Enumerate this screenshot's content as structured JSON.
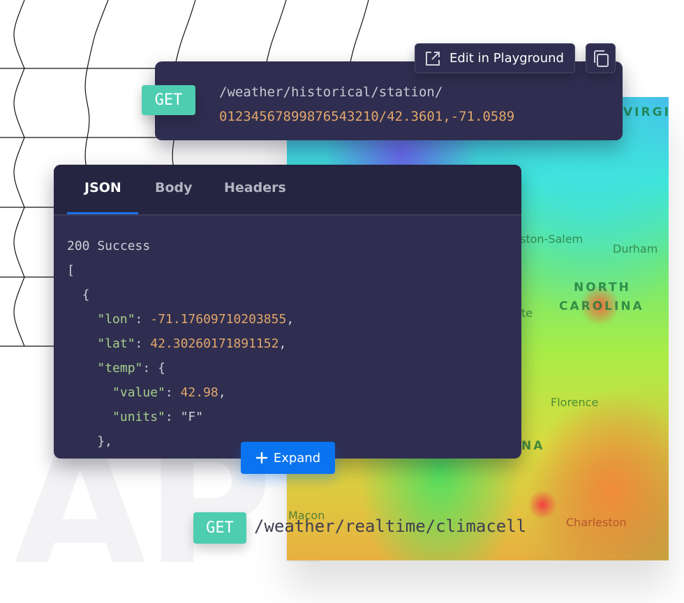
{
  "map": {
    "labels": {
      "virginia": "VIRGI",
      "winston_salem": "ston-Salem",
      "durham": "Durham",
      "state_line1": "NORTH",
      "state_line2": "CAROLINA",
      "partial_te": "te",
      "florence": "Florence",
      "partial_na": "NA",
      "macon": "Macon",
      "charleston": "Charleston"
    }
  },
  "watermark": "API",
  "endpoint_card": {
    "method": "GET",
    "path_line1": "/weather/historical/station/",
    "path_line2": "01234567899876543210/42.3601,-71.0589",
    "edit_button_label": "Edit in Playground",
    "edit_icon": "external-link-icon",
    "copy_icon": "copy-icon"
  },
  "json_card": {
    "tabs": [
      {
        "label": "JSON",
        "active": true
      },
      {
        "label": "Body",
        "active": false
      },
      {
        "label": "Headers",
        "active": false
      }
    ],
    "accent": "#1a73e8",
    "status": "200 Success",
    "fields": {
      "lon_key": "\"lon\"",
      "lon_value": "-71.17609710203855",
      "lat_key": "\"lat\"",
      "lat_value": "42.30260171891152",
      "temp_key": "\"temp\"",
      "value_key": "\"value\"",
      "value_value": "42.98",
      "units_key": "\"units\"",
      "units_value": "\"F\""
    }
  },
  "expand_button": {
    "label": "Expand",
    "icon": "plus-icon",
    "color": "#0a74f0"
  },
  "bottom_endpoint": {
    "method": "GET",
    "path": "/weather/realtime/climacell"
  },
  "colors": {
    "get_badge": "#4ecdb1",
    "card_bg": "#2f2e50"
  }
}
